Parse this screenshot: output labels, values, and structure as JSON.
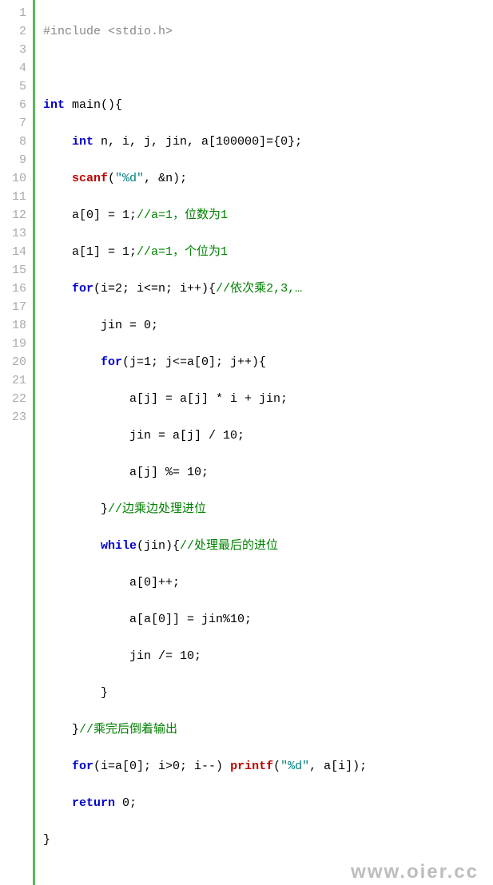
{
  "watermark": "www.oier.cc",
  "line_numbers": [
    "1",
    "2",
    "3",
    "4",
    "5",
    "6",
    "7",
    "8",
    "9",
    "10",
    "11",
    "12",
    "13",
    "14",
    "15",
    "16",
    "17",
    "18",
    "19",
    "20",
    "21",
    "22",
    "23"
  ],
  "code": {
    "l1": {
      "macro": "#include <stdio.h>"
    },
    "l2": {
      "blank": " "
    },
    "l3": {
      "kw1": "int",
      "rest": " main(){"
    },
    "l4": {
      "indent": "    ",
      "kw1": "int",
      "rest": " n, i, j, jin, a[100000]={0};"
    },
    "l5": {
      "indent": "    ",
      "fn": "scanf",
      "p1": "(",
      "str": "\"%d\"",
      "p2": ", &n);"
    },
    "l6": {
      "indent": "    ",
      "code": "a[0] = 1;",
      "cm": "//a=1，位数为1"
    },
    "l7": {
      "indent": "    ",
      "code": "a[1] = 1;",
      "cm": "//a=1，个位为1"
    },
    "l8": {
      "indent": "    ",
      "kw1": "for",
      "code": "(i=2; i<=n; i++){",
      "cm": "//依次乘2,3,…"
    },
    "l9": {
      "indent": "        ",
      "code": "jin = 0;"
    },
    "l10": {
      "indent": "        ",
      "kw1": "for",
      "code": "(j=1; j<=a[0]; j++){"
    },
    "l11": {
      "indent": "            ",
      "code": "a[j] = a[j] * i + jin;"
    },
    "l12": {
      "indent": "            ",
      "code": "jin = a[j] / 10;"
    },
    "l13": {
      "indent": "            ",
      "code": "a[j] %= 10;"
    },
    "l14": {
      "indent": "        ",
      "code": "}",
      "cm": "//边乘边处理进位"
    },
    "l15": {
      "indent": "        ",
      "kw1": "while",
      "code": "(jin){",
      "cm": "//处理最后的进位"
    },
    "l16": {
      "indent": "            ",
      "code": "a[0]++;"
    },
    "l17": {
      "indent": "            ",
      "code": "a[a[0]] = jin%10;"
    },
    "l18": {
      "indent": "            ",
      "code": "jin /= 10;"
    },
    "l19": {
      "indent": "        ",
      "code": "}"
    },
    "l20": {
      "indent": "    ",
      "code": "}",
      "cm": "//乘完后倒着输出"
    },
    "l21": {
      "indent": "    ",
      "kw1": "for",
      "mid": "(i=a[0]; i>0; i--) ",
      "fn": "printf",
      "p1": "(",
      "str": "\"%d\"",
      "p2": ", a[i]);"
    },
    "l22": {
      "indent": "    ",
      "kw1": "return",
      "code": " 0;"
    },
    "l23": {
      "code": "}"
    }
  }
}
